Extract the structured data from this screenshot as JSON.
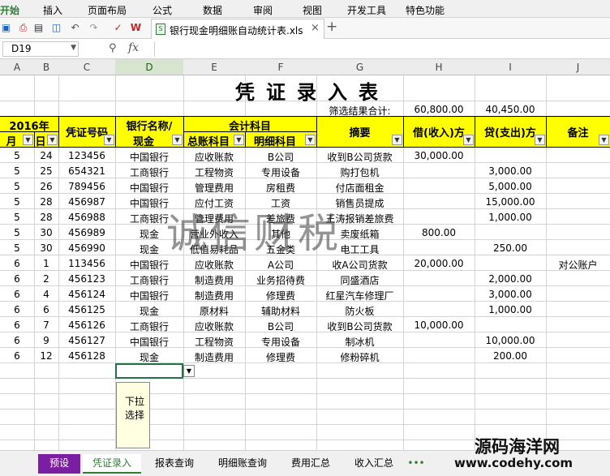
{
  "menu": [
    "开始",
    "插入",
    "页面布局",
    "公式",
    "数据",
    "审阅",
    "视图",
    "开发工具",
    "特色功能"
  ],
  "file_tab": {
    "name": "银行现金明细账自动统计表.xls",
    "close": "×",
    "add": "+",
    "doc_icon": "xls-file-icon"
  },
  "formula_bar": {
    "cell_ref": "D19",
    "fx": "fx",
    "content": ""
  },
  "columns": [
    "A",
    "B",
    "C",
    "D",
    "E",
    "F",
    "G",
    "H",
    "I",
    "J"
  ],
  "selected_column": "D",
  "sheet": {
    "title": "凭证录入表",
    "filter_label": "筛选结果合计:",
    "debit_total": "60,800.00",
    "credit_total": "40,450.00",
    "headers": {
      "year": "2016年",
      "month": "月",
      "day": "日",
      "voucher": "凭证号码",
      "bank_top": "银行名称/",
      "bank_bottom": "现金",
      "accounting_subject": "会计科目",
      "general_ledger": "总账科目",
      "detail_subject": "明细科目",
      "summary": "摘要",
      "debit": "借(收入)方",
      "credit": "贷(支出)方",
      "remark": "备注"
    },
    "rows": [
      {
        "month": "5",
        "day": "24",
        "voucher": "123456",
        "bank": "中国银行",
        "general": "应收账款",
        "detail": "B公司",
        "summary": "收到B公司货款",
        "debit": "30,000.00",
        "credit": "",
        "remark": ""
      },
      {
        "month": "5",
        "day": "25",
        "voucher": "654321",
        "bank": "工商银行",
        "general": "工程物资",
        "detail": "专用设备",
        "summary": "购打包机",
        "debit": "",
        "credit": "3,000.00",
        "remark": ""
      },
      {
        "month": "5",
        "day": "26",
        "voucher": "789456",
        "bank": "中国银行",
        "general": "管理费用",
        "detail": "房租费",
        "summary": "付店面租金",
        "debit": "",
        "credit": "5,000.00",
        "remark": ""
      },
      {
        "month": "5",
        "day": "28",
        "voucher": "456987",
        "bank": "中国银行",
        "general": "应付工资",
        "detail": "工资",
        "summary": "销售员提成",
        "debit": "",
        "credit": "15,000.00",
        "remark": ""
      },
      {
        "month": "5",
        "day": "28",
        "voucher": "456988",
        "bank": "工商银行",
        "general": "管理费用",
        "detail": "差旅费",
        "summary": "王涛报销差旅费",
        "debit": "",
        "credit": "1,000.00",
        "remark": ""
      },
      {
        "month": "5",
        "day": "30",
        "voucher": "456989",
        "bank": "现金",
        "general": "营业外收入",
        "detail": "其他",
        "summary": "卖废纸箱",
        "debit": "800.00",
        "credit": "",
        "remark": ""
      },
      {
        "month": "5",
        "day": "30",
        "voucher": "456990",
        "bank": "现金",
        "general": "低值易耗品",
        "detail": "五金类",
        "summary": "电工工具",
        "debit": "",
        "credit": "250.00",
        "remark": ""
      },
      {
        "month": "6",
        "day": "1",
        "voucher": "113456",
        "bank": "中国银行",
        "general": "应收账款",
        "detail": "A公司",
        "summary": "收A公司货款",
        "debit": "20,000.00",
        "credit": "",
        "remark": "对公账户"
      },
      {
        "month": "6",
        "day": "2",
        "voucher": "456123",
        "bank": "工商银行",
        "general": "制造费用",
        "detail": "业务招待费",
        "summary": "同盛酒店",
        "debit": "",
        "credit": "2,000.00",
        "remark": ""
      },
      {
        "month": "6",
        "day": "4",
        "voucher": "456124",
        "bank": "中国银行",
        "general": "制造费用",
        "detail": "修理费",
        "summary": "红星汽车修理厂",
        "debit": "",
        "credit": "3,000.00",
        "remark": ""
      },
      {
        "month": "6",
        "day": "6",
        "voucher": "456125",
        "bank": "现金",
        "general": "原材料",
        "detail": "辅助材料",
        "summary": "防火板",
        "debit": "",
        "credit": "1,000.00",
        "remark": ""
      },
      {
        "month": "6",
        "day": "7",
        "voucher": "456126",
        "bank": "工商银行",
        "general": "应收账款",
        "detail": "B公司",
        "summary": "收到B公司货款",
        "debit": "10,000.00",
        "credit": "",
        "remark": ""
      },
      {
        "month": "6",
        "day": "9",
        "voucher": "456127",
        "bank": "中国银行",
        "general": "工程物资",
        "detail": "专用设备",
        "summary": "制冰机",
        "debit": "",
        "credit": "10,000.00",
        "remark": ""
      },
      {
        "month": "6",
        "day": "12",
        "voucher": "456128",
        "bank": "现金",
        "general": "制造费用",
        "detail": "修理费",
        "summary": "修粉碎机",
        "debit": "",
        "credit": "200.00",
        "remark": ""
      }
    ],
    "hint": "下拉选择"
  },
  "watermarks": {
    "center": "诚信财税",
    "corner_cn": "源码海洋网",
    "corner_url": "www.codehy.com"
  },
  "sheet_tabs": [
    "预设",
    "凭证录入",
    "报表查询",
    "明细账查询",
    "费用汇总",
    "收入汇总"
  ],
  "active_sheet_tab": "凭证录入",
  "more_tabs": "•••",
  "colors": {
    "header_band": "#ffff00",
    "preset_tab": "#7b1fa2",
    "active_tab_text": "#2e7d32",
    "selection": "#217346"
  }
}
